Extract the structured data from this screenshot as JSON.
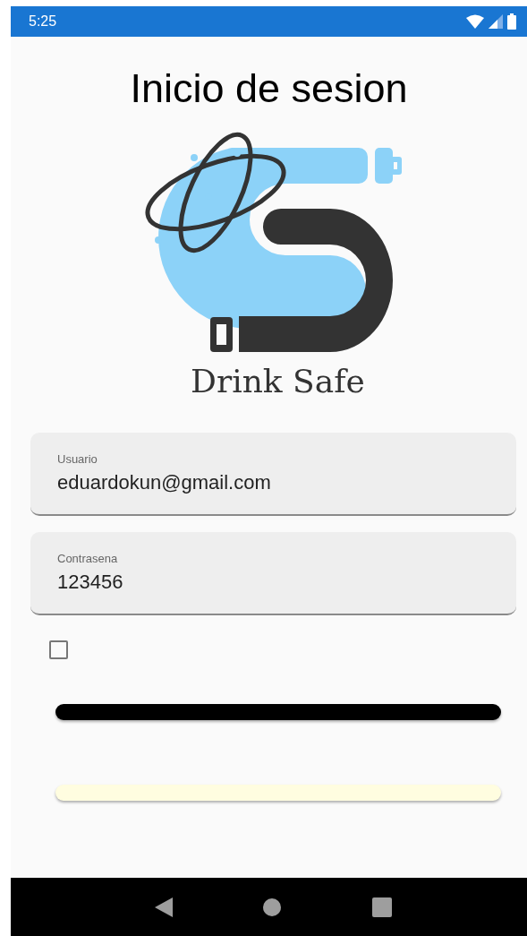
{
  "status_bar": {
    "time": "5:25"
  },
  "title": "Inicio de sesion",
  "logo": {
    "text": "Drink Safe"
  },
  "fields": [
    {
      "label": "Usuario",
      "value": "eduardokun@gmail.com"
    },
    {
      "label": "Contrasena",
      "value": "123456"
    }
  ],
  "checkbox": {
    "checked": false
  },
  "buttons": [
    {
      "color": "#000000"
    },
    {
      "color": "#fffde0"
    }
  ]
}
